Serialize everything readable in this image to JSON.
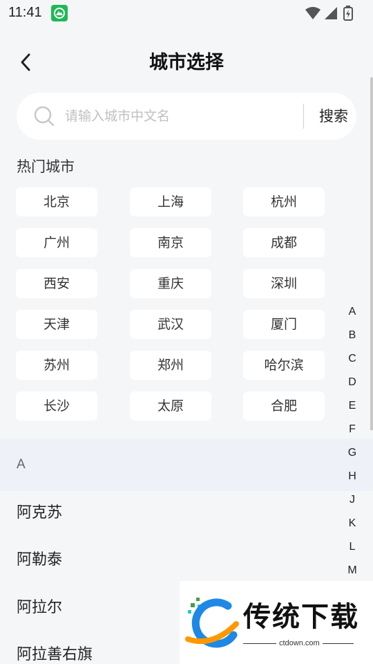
{
  "status_bar": {
    "time": "11:41",
    "notification_icon": "mountain-app-icon",
    "icons": [
      "wifi-icon",
      "signal-icon",
      "battery-charging-icon"
    ]
  },
  "header": {
    "title": "城市选择",
    "back_icon": "back-arrow-icon"
  },
  "search": {
    "placeholder": "请输入城市中文名",
    "value": "",
    "button_label": "搜索",
    "icon": "search-icon"
  },
  "hot_cities": {
    "title": "热门城市",
    "items": [
      "北京",
      "上海",
      "杭州",
      "广州",
      "南京",
      "成都",
      "西安",
      "重庆",
      "深圳",
      "天津",
      "武汉",
      "厦门",
      "苏州",
      "郑州",
      "哈尔滨",
      "长沙",
      "太原",
      "合肥"
    ]
  },
  "city_list": {
    "section_letter": "A",
    "items": [
      "阿克苏",
      "阿勒泰",
      "阿拉尔",
      "阿拉善右旗"
    ]
  },
  "index_bar": {
    "letters": [
      "A",
      "B",
      "C",
      "D",
      "E",
      "F",
      "G",
      "H",
      "J",
      "K",
      "L",
      "M"
    ]
  },
  "watermark": {
    "brand": "传统下载",
    "url": "ctdown.com"
  },
  "colors": {
    "background": "#f5f6f8",
    "section_header": "#eef1f8",
    "chip_background": "#ffffff",
    "watermark_blue": "#1e88e5",
    "watermark_orange": "#ff9800",
    "watermark_green": "#43a047"
  }
}
